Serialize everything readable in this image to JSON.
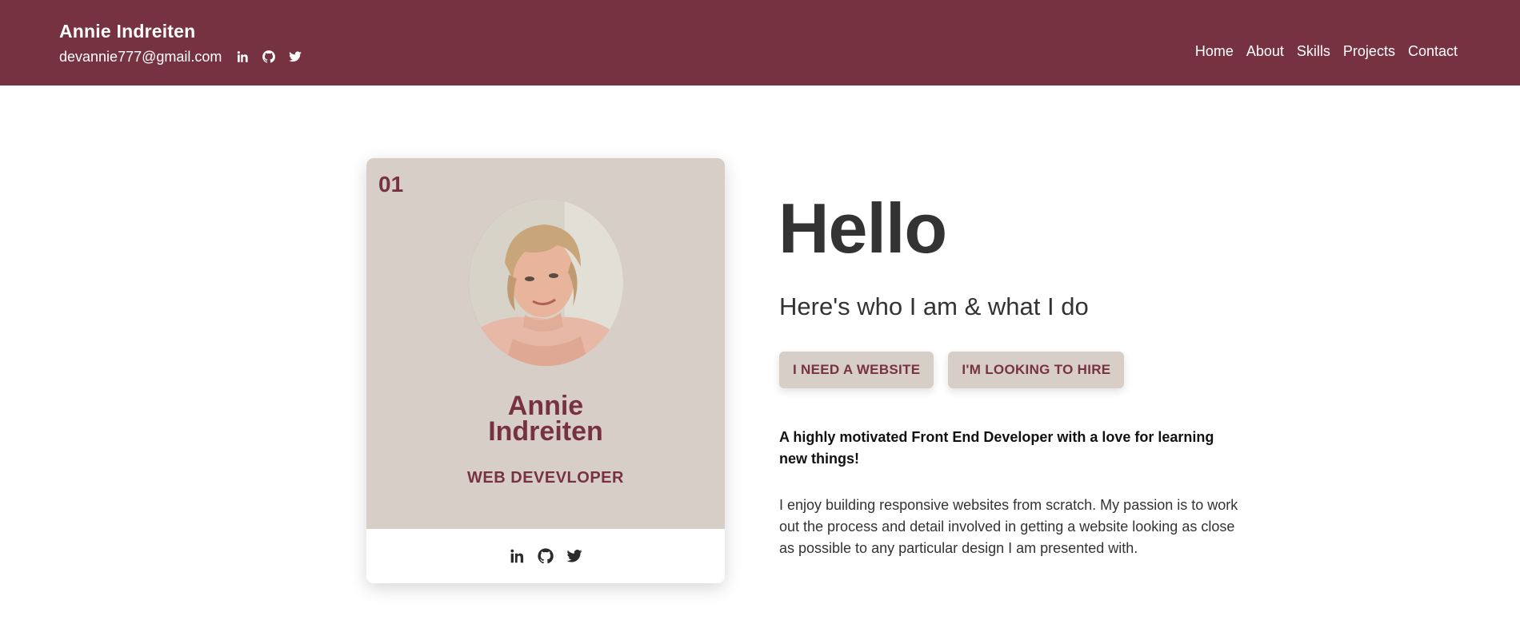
{
  "header": {
    "brand_name": "Annie Indreiten",
    "email": "devannie777@gmail.com",
    "social_icons": [
      "linkedin-icon",
      "github-icon",
      "twitter-icon"
    ],
    "nav": [
      "Home",
      "About",
      "Skills",
      "Projects",
      "Contact"
    ]
  },
  "card": {
    "number": "01",
    "name_line1": "Annie",
    "name_line2": "Indreiten",
    "role": "WEB DEVEVLOPER",
    "social_icons": [
      "linkedin-icon",
      "github-icon",
      "twitter-icon"
    ]
  },
  "hero": {
    "title": "Hello",
    "subtitle": "Here's who I am & what I do",
    "buttons": [
      "I NEED A WEBSITE",
      "I'M LOOKING TO HIRE"
    ],
    "lead": "A highly motivated Front End Developer with a love for learning new things!",
    "body": "I enjoy building responsive websites from scratch. My passion is to work out the process and detail involved in getting a website looking as close as possible to any particular design I am presented with."
  },
  "colors": {
    "brand": "#773241",
    "card_bg": "#d8cec8",
    "text_dark": "#333333"
  }
}
